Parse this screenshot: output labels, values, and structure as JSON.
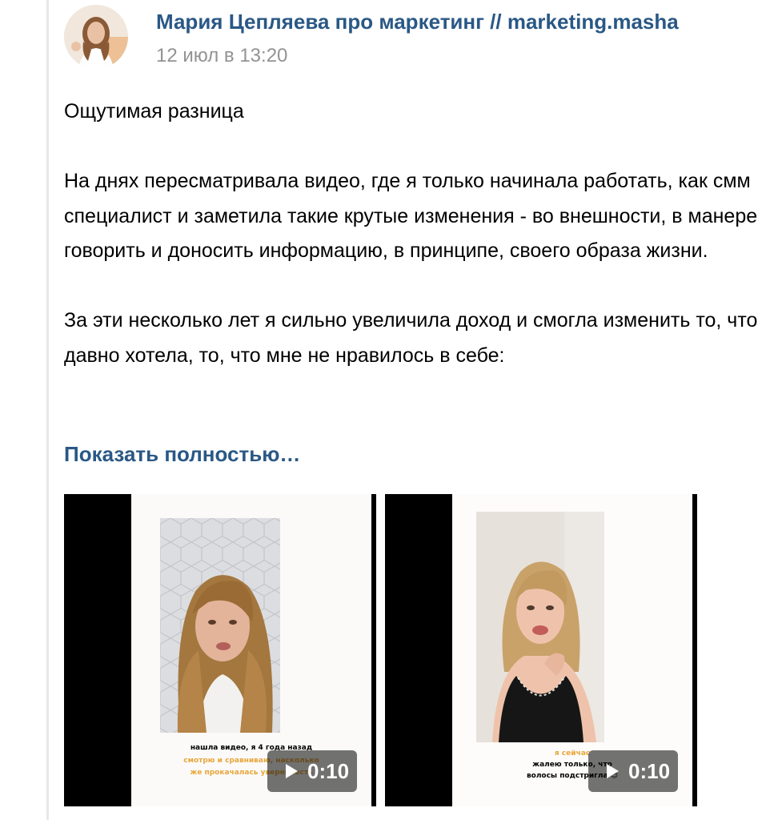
{
  "post": {
    "author": "Мария Цепляева про маркетинг // marketing.masha",
    "date": "12 июл в 13:20",
    "paragraphs": [
      "Ощутимая разница",
      "На днях пересматривала видео, где я только начинала работать, как смм специалист и заметила такие крутые изменения - во внешности, в манере говорить и доносить информацию, в принципе, своего образа жизни.",
      "За эти несколько лет я сильно увеличила доход и смогла изменить то, что давно хотела, то, что мне не нравилось в себе:"
    ],
    "show_more": "Показать полностью…"
  },
  "videos": [
    {
      "duration": "0:10",
      "caption_lines": [
        "нашла видео, я 4 года назад",
        "смотрю и сравниваю, насколько",
        "же прокачалась уверенность"
      ]
    },
    {
      "duration": "0:10",
      "caption_lines": [
        "я сейчас",
        "жалею только, что",
        "волосы подстригла 😊"
      ]
    }
  ],
  "colors": {
    "link": "#2a5885",
    "meta": "#939393",
    "caption_accent": "#e8a63a"
  }
}
